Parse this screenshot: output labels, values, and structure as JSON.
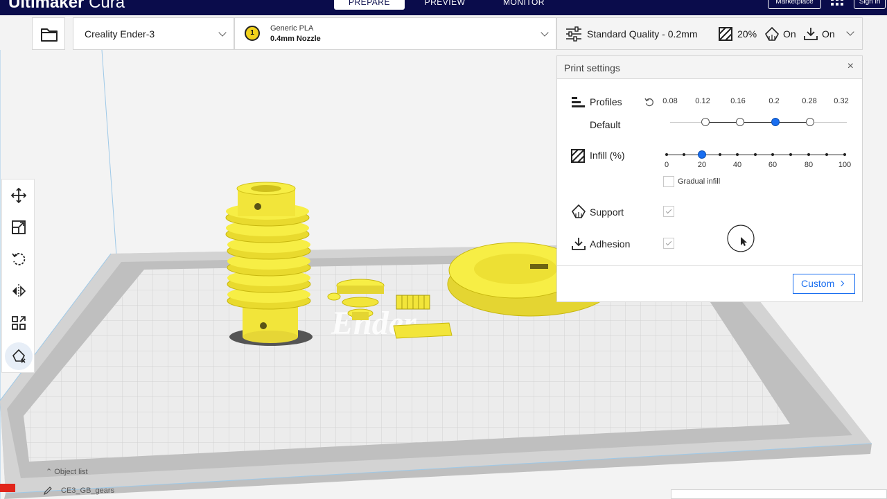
{
  "app": {
    "brand_bold": "Ultimaker",
    "brand_light": "Cura"
  },
  "stages": [
    {
      "label": "PREPARE",
      "active": true
    },
    {
      "label": "PREVIEW",
      "active": false
    },
    {
      "label": "MONITOR",
      "active": false
    }
  ],
  "header": {
    "marketplace_label": "Marketplace",
    "signin_label": "Sign in"
  },
  "toolbar": {
    "printer": "Creality Ender-3",
    "material": {
      "extruder_number": "1",
      "name": "Generic PLA",
      "nozzle": "0.4mm Nozzle"
    },
    "settings_summary": {
      "quality": "Standard Quality - 0.2mm",
      "infill": "20%",
      "support": "On",
      "adhesion": "On"
    }
  },
  "print_settings": {
    "title": "Print settings",
    "profiles": {
      "label": "Profiles",
      "current": "Default",
      "layer_heights": [
        "0.08",
        "0.12",
        "0.16",
        "0.2",
        "0.28",
        "0.32"
      ],
      "selected": "0.2"
    },
    "infill": {
      "label": "Infill (%)",
      "ticks": [
        "0",
        "20",
        "40",
        "60",
        "80",
        "100"
      ],
      "value": 20,
      "gradual_label": "Gradual infill",
      "gradual_checked": false
    },
    "support": {
      "label": "Support",
      "checked": true
    },
    "adhesion": {
      "label": "Adhesion",
      "checked": true
    },
    "custom_label": "Custom"
  },
  "object_list": {
    "header": "Object list",
    "file_name": "CE3_GB_gears"
  },
  "build_plate": {
    "logo_text": "Ender"
  },
  "colors": {
    "header_bg": "#0a0c4b",
    "accent": "#196ef0",
    "model_yellow": "#f7ee45"
  }
}
